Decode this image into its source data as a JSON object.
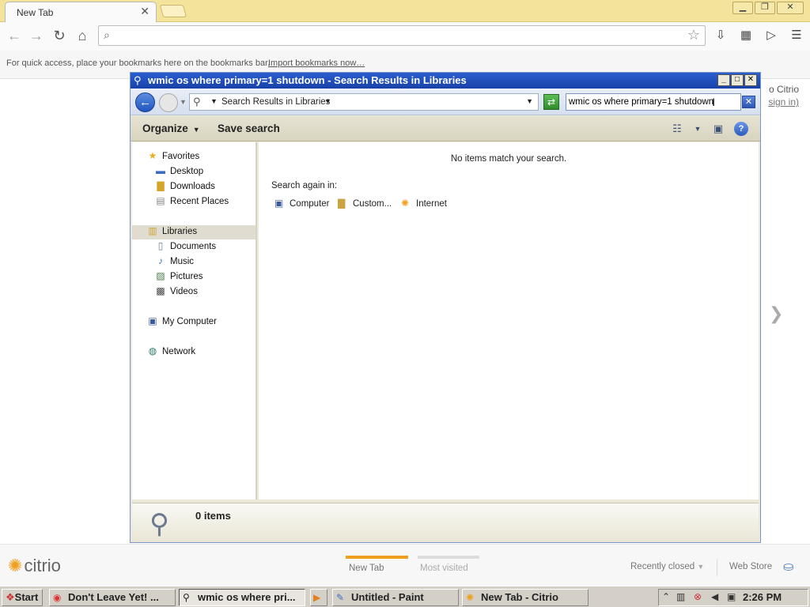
{
  "browser": {
    "tab_title": "New Tab",
    "tab_close": "✕",
    "window_controls": {
      "minimize": "▁",
      "restore": "❐",
      "close": "✕"
    },
    "toolbar": {
      "back": "←",
      "forward": "→",
      "reload": "↻",
      "home": "⌂",
      "star": "☆"
    },
    "omnibox_value": "",
    "bookmarks_bar": {
      "text": "For quick access, place your bookmarks here on the bookmarks bar.",
      "link": "Import bookmarks now…"
    },
    "behind": {
      "text": "o Citrio",
      "link": "sign in)"
    },
    "next_arrow": "❯"
  },
  "explorer": {
    "title": "wmic os where primary=1 shutdown - Search Results in Libraries",
    "window_controls": {
      "minimize": "_",
      "maximize": "□",
      "close": "✕"
    },
    "address_crumb": "Search Results in Libraries",
    "search_value": "wmic os where primary=1 shutdown",
    "commands": {
      "organize": "Organize",
      "save_search": "Save search"
    },
    "nav": {
      "favorites": "Favorites",
      "favorites_items": [
        "Desktop",
        "Downloads",
        "Recent Places"
      ],
      "libraries": "Libraries",
      "libraries_items": [
        "Documents",
        "Music",
        "Pictures",
        "Videos"
      ],
      "my_computer": "My Computer",
      "network": "Network"
    },
    "content": {
      "no_items": "No items match your search.",
      "search_again": "Search again in:",
      "links": [
        "Computer",
        "Custom...",
        "Internet"
      ]
    },
    "details": {
      "count": "0 items"
    }
  },
  "newtab_bottom": {
    "logo": "citrio",
    "tabs": [
      "New Tab",
      "Most visited"
    ],
    "recently_closed": "Recently closed",
    "web_store": "Web Store"
  },
  "taskbar": {
    "start": "Start",
    "tasks": [
      "Don't Leave Yet! ...",
      "wmic os where pri...",
      "Untitled - Paint",
      "New Tab - Citrio"
    ],
    "clock": "2:26 PM"
  },
  "colors": {
    "titlebar": "#f3e39b",
    "explorer_title": "#1f4fbb",
    "accent_orange": "#f0a020"
  }
}
